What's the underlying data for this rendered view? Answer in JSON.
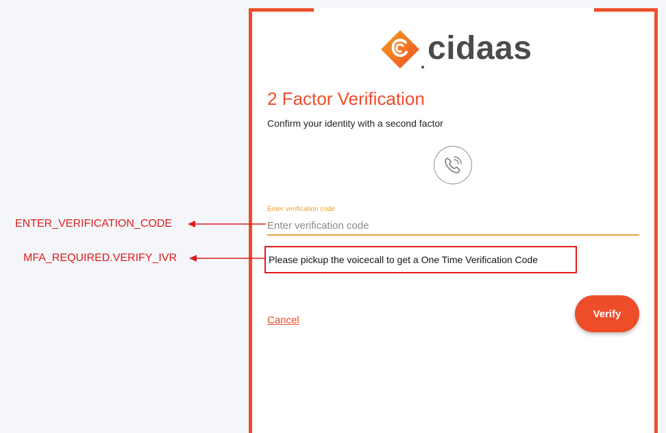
{
  "brand": {
    "name": "cidaas",
    "accent_color": "#ee4d2a"
  },
  "page": {
    "title": "2 Factor Verification",
    "subtitle": "Confirm your identity with a second factor",
    "factor_icon": "phone-call-icon"
  },
  "form": {
    "code_label": "Enter verification code",
    "code_placeholder": "Enter verification code",
    "code_value": "",
    "info_message": "Please pickup the voicecall to get a One Time Verification Code",
    "cancel_label": "Cancel",
    "verify_label": "Verify"
  },
  "annotations": {
    "code_key": "ENTER_VERIFICATION_CODE",
    "info_key": "MFA_REQUIRED.VERIFY_IVR",
    "color": "#e11a1a"
  }
}
